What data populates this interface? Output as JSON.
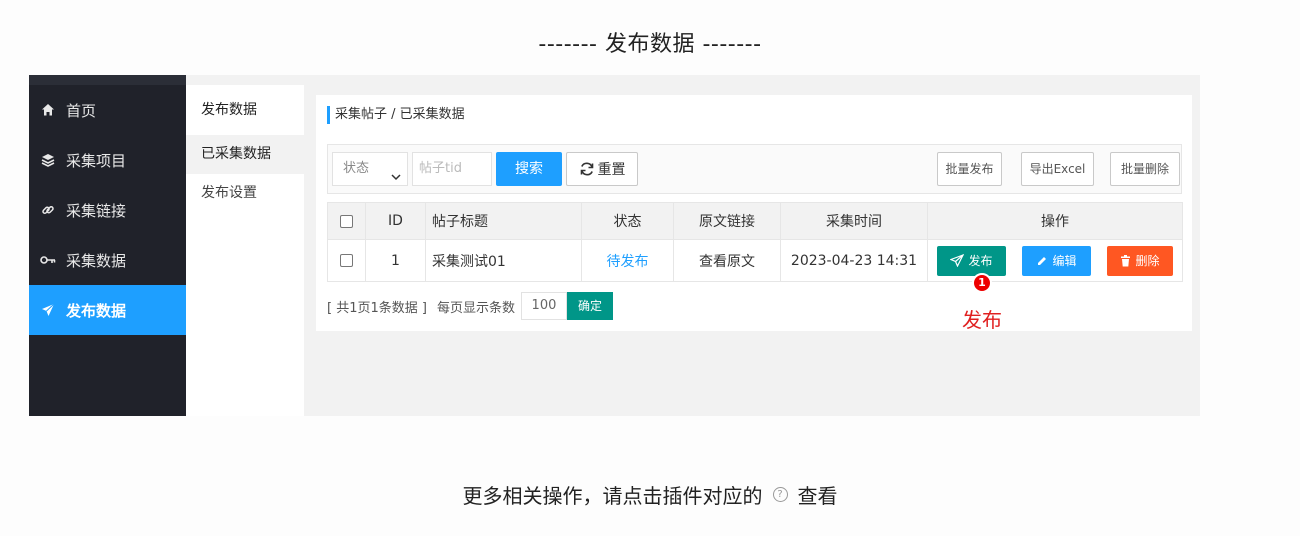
{
  "page_heading": "------- 发布数据 -------",
  "sidebar": {
    "items": [
      {
        "label": "首页",
        "icon": "home-icon"
      },
      {
        "label": "采集项目",
        "icon": "layers-icon"
      },
      {
        "label": "采集链接",
        "icon": "link-icon"
      },
      {
        "label": "采集数据",
        "icon": "key-icon"
      },
      {
        "label": "发布数据",
        "icon": "send-icon",
        "active": true
      }
    ]
  },
  "subnav": {
    "title": "发布数据",
    "items": [
      {
        "label": "已采集数据",
        "active": true
      },
      {
        "label": "发布设置"
      }
    ]
  },
  "breadcrumb": "采集帖子 / 已采集数据",
  "toolbar": {
    "status_select": "状态",
    "tid_placeholder": "帖子tid",
    "search_label": "搜索",
    "reset_label": "重置",
    "batch_publish": "批量发布",
    "export_excel": "导出Excel",
    "batch_delete": "批量删除"
  },
  "table": {
    "headers": [
      "ID",
      "帖子标题",
      "状态",
      "原文链接",
      "采集时间",
      "操作"
    ],
    "rows": [
      {
        "id": "1",
        "title": "采集测试01",
        "status": "待发布",
        "link": "查看原文",
        "time": "2023-04-23 14:31",
        "actions": {
          "publish": "发布",
          "edit": "编辑",
          "delete": "删除"
        }
      }
    ]
  },
  "pager": {
    "summary": "[ 共1页1条数据 ]",
    "per_page_label": "每页显示条数",
    "per_page_value": "100",
    "confirm": "确定"
  },
  "annotation": {
    "number": "1",
    "label": "发布"
  },
  "footer": {
    "text_before": "更多相关操作，请点击插件对应的",
    "help_symbol": "?",
    "text_after": "查看"
  },
  "colors": {
    "primary": "#1e9fff",
    "teal": "#009688",
    "danger": "#ff5722",
    "sidebar_bg": "#20222a"
  }
}
